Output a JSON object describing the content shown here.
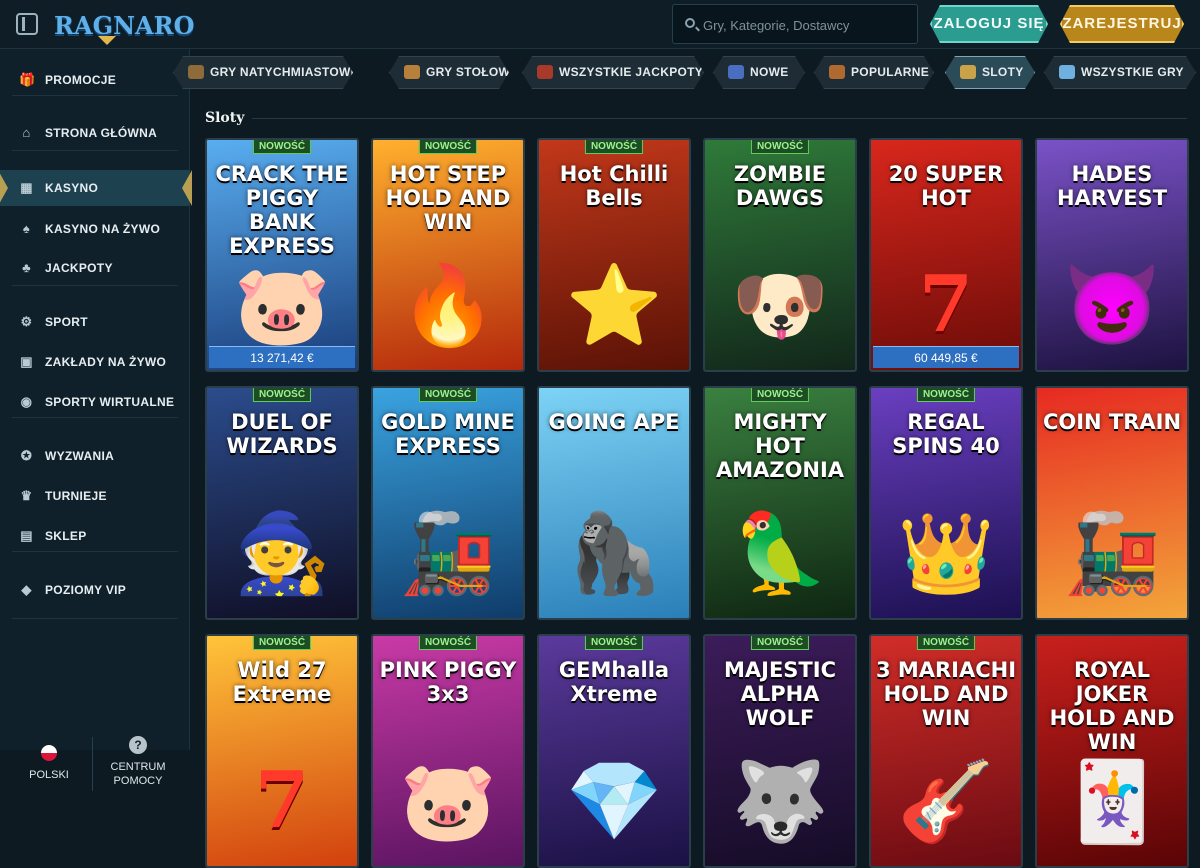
{
  "header": {
    "logo": "RAGNARO",
    "search_placeholder": "Gry, Kategorie, Dostawcy",
    "login": "ZALOGUJ SIĘ",
    "register": "ZAREJESTRUJ"
  },
  "sidebar": {
    "items": [
      {
        "label": "PROMOCJE",
        "icon": "gift-icon"
      },
      {
        "label": "STRONA GŁÓWNA",
        "icon": "home-icon"
      },
      {
        "label": "KASYNO",
        "icon": "slot-machine-icon"
      },
      {
        "label": "KASYNO NA ŻYWO",
        "icon": "cards-icon"
      },
      {
        "label": "JACKPOTY",
        "icon": "clover-icon"
      },
      {
        "label": "SPORT",
        "icon": "gear-icon"
      },
      {
        "label": "ZAKŁADY NA ŻYWO",
        "icon": "live-icon"
      },
      {
        "label": "SPORTY WIRTUALNE",
        "icon": "controller-icon"
      },
      {
        "label": "WYZWANIA",
        "icon": "medal-icon"
      },
      {
        "label": "TURNIEJE",
        "icon": "trophy-icon"
      },
      {
        "label": "SKLEP",
        "icon": "basket-icon"
      },
      {
        "label": "POZIOMY VIP",
        "icon": "diamond-icon"
      }
    ],
    "language": "POLSKI",
    "help": "CENTRUM POMOCY"
  },
  "categories": [
    {
      "label": "GRY NATYCHMIASTOWE",
      "icon": "rocket-icon"
    },
    {
      "label": "GRY STOŁOWE",
      "icon": "table-icon"
    },
    {
      "label": "WSZYSTKIE JACKPOTY",
      "icon": "jackpot-icon"
    },
    {
      "label": "NOWE",
      "icon": "new-icon"
    },
    {
      "label": "POPULARNE",
      "icon": "popular-icon"
    },
    {
      "label": "SLOTY",
      "icon": "slots-icon"
    },
    {
      "label": "WSZYSTKIE GRY",
      "icon": "all-games-icon"
    }
  ],
  "section_title": "Sloty",
  "badge_label": "NOWOŚĆ",
  "games": [
    {
      "title": "CRACK THE PIGGY BANK EXPRESS",
      "badge": true,
      "jackpot": "13 271,42 €",
      "colors": [
        "#59aef0",
        "#1a3c7a"
      ],
      "symbol": "🐷"
    },
    {
      "title": "HOT STEP HOLD AND WIN",
      "badge": true,
      "jackpot": "",
      "colors": [
        "#ffb02e",
        "#b4280c"
      ],
      "symbol": "🔥"
    },
    {
      "title": "Hot Chilli Bells",
      "badge": true,
      "jackpot": "",
      "colors": [
        "#c2381a",
        "#5a1206"
      ],
      "symbol": "⭐"
    },
    {
      "title": "ZOMBIE DAWGS",
      "badge": true,
      "jackpot": "",
      "colors": [
        "#2f7a3a",
        "#12261a"
      ],
      "symbol": "🐶"
    },
    {
      "title": "20 SUPER HOT",
      "badge": false,
      "jackpot": "60 449,85 €",
      "colors": [
        "#d8271c",
        "#6b0b08"
      ],
      "symbol": "7"
    },
    {
      "title": "HADES HARVEST",
      "badge": false,
      "jackpot": "",
      "colors": [
        "#7a52c7",
        "#1d1240"
      ],
      "symbol": "😈"
    },
    {
      "title": "DUEL OF WIZARDS",
      "badge": true,
      "jackpot": "",
      "colors": [
        "#2b4c8c",
        "#100f26"
      ],
      "symbol": "🧙"
    },
    {
      "title": "GOLD MINE EXPRESS",
      "badge": true,
      "jackpot": "",
      "colors": [
        "#3aa3e0",
        "#0f3c6a"
      ],
      "symbol": "🚂"
    },
    {
      "title": "GOING APE",
      "badge": false,
      "jackpot": "",
      "colors": [
        "#7dd3f5",
        "#2a7fb8"
      ],
      "symbol": "🦍"
    },
    {
      "title": "MIGHTY HOT AMAZONIA",
      "badge": true,
      "jackpot": "",
      "colors": [
        "#3a8040",
        "#0f2612"
      ],
      "symbol": "🦜"
    },
    {
      "title": "REGAL SPINS 40",
      "badge": true,
      "jackpot": "",
      "colors": [
        "#6a3fc0",
        "#1b1050"
      ],
      "symbol": "👑"
    },
    {
      "title": "COIN TRAIN",
      "badge": false,
      "jackpot": "",
      "colors": [
        "#e62a22",
        "#f3a53a"
      ],
      "symbol": "🚂"
    },
    {
      "title": "Wild 27 Extreme",
      "badge": true,
      "jackpot": "",
      "colors": [
        "#ffc43a",
        "#d2410e"
      ],
      "symbol": "7"
    },
    {
      "title": "PINK PIGGY 3x3",
      "badge": true,
      "jackpot": "",
      "colors": [
        "#c93aa6",
        "#5a1460"
      ],
      "symbol": "🐷"
    },
    {
      "title": "GEMhalla Xtreme",
      "badge": true,
      "jackpot": "",
      "colors": [
        "#5b3a9c",
        "#1a1144"
      ],
      "symbol": "💎"
    },
    {
      "title": "MAJESTIC ALPHA WOLF",
      "badge": true,
      "jackpot": "",
      "colors": [
        "#3c1c5a",
        "#150c26"
      ],
      "symbol": "🐺"
    },
    {
      "title": "3 MARIACHI HOLD AND WIN",
      "badge": true,
      "jackpot": "",
      "colors": [
        "#d12d28",
        "#6a0b12"
      ],
      "symbol": "🎸"
    },
    {
      "title": "ROYAL JOKER HOLD AND WIN",
      "badge": false,
      "jackpot": "",
      "colors": [
        "#c8201c",
        "#5a0406"
      ],
      "symbol": "🃏"
    }
  ]
}
